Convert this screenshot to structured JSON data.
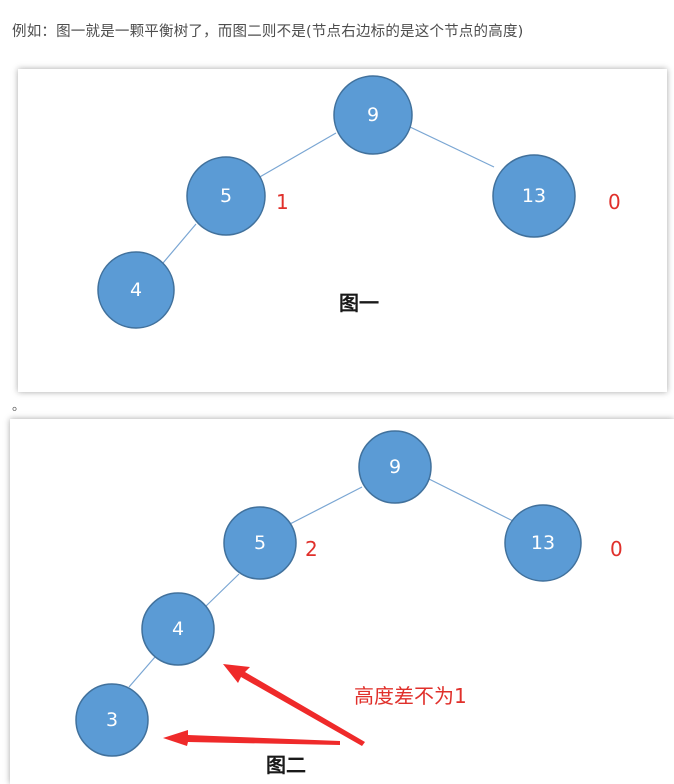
{
  "intro_text": "例如：图一就是一颗平衡树了，而图二则不是(节点右边标的是这个节点的高度)",
  "separator": "。",
  "figure1": {
    "caption": "图一",
    "nodes": [
      "9",
      "5",
      "13",
      "4"
    ],
    "heights": {
      "node_5": "1",
      "node_13": "0"
    }
  },
  "figure2": {
    "caption": "图二",
    "nodes": [
      "9",
      "5",
      "13",
      "4",
      "3"
    ],
    "heights": {
      "node_5": "2",
      "node_13": "0"
    },
    "annotation": "高度差不为1"
  },
  "colors": {
    "node_fill": "#5b9bd5",
    "node_stroke": "#41719c",
    "height_label": "#e0302b",
    "arrow": "#ef2a2a"
  }
}
